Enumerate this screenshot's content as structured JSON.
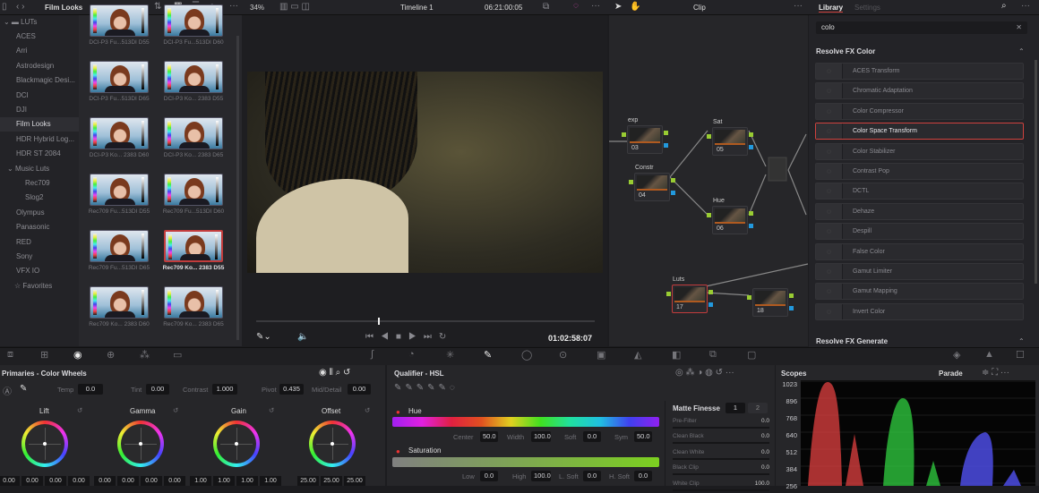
{
  "topbar": {
    "bin_title": "Film Looks",
    "zoom": "34%",
    "timeline": "Timeline 1",
    "timecode": "06:21:00:05",
    "node_mode": "Clip"
  },
  "sidebar": {
    "root": "LUTs",
    "items": [
      {
        "label": "ACES"
      },
      {
        "label": "Arri"
      },
      {
        "label": "Astrodesign"
      },
      {
        "label": "Blackmagic Desi..."
      },
      {
        "label": "DCI"
      },
      {
        "label": "DJI"
      },
      {
        "label": "Film Looks",
        "selected": true
      },
      {
        "label": "HDR Hybrid Log..."
      },
      {
        "label": "HDR ST 2084"
      },
      {
        "label": "Music Luts"
      },
      {
        "label": "Rec709"
      },
      {
        "label": "Slog2"
      },
      {
        "label": "Olympus"
      },
      {
        "label": "Panasonic"
      },
      {
        "label": "RED"
      },
      {
        "label": "Sony"
      },
      {
        "label": "VFX IO"
      },
      {
        "label": "Favorites"
      }
    ]
  },
  "luts": [
    "DCI-P3 Fu...513DI D55",
    "DCI-P3 Fu...513DI D60",
    "DCI-P3 Fu...513DI D65",
    "DCI-P3 Ko... 2383 D55",
    "DCI-P3 Ko... 2383 D60",
    "DCI-P3 Ko... 2383 D65",
    "Rec709 Fu...513DI D55",
    "Rec709 Fu...513DI D60",
    "Rec709 Fu...513DI D65",
    "Rec709 Ko... 2383 D55",
    "Rec709 Ko... 2383 D60",
    "Rec709 Ko... 2383 D65"
  ],
  "viewer": {
    "timecode": "01:02:58:07",
    "playhead_fraction": 0.36
  },
  "nodes": [
    {
      "label": "exp",
      "num": "03"
    },
    {
      "label": "Constr",
      "num": "04"
    },
    {
      "label": "Sat",
      "num": "05"
    },
    {
      "label": "Hue",
      "num": "06"
    },
    {
      "label": "Luts",
      "num": "17"
    },
    {
      "label": "",
      "num": "18"
    }
  ],
  "library": {
    "tabs": [
      "Library",
      "Settings"
    ],
    "search": "colo",
    "section1": "Resolve FX Color",
    "section2": "Resolve FX Generate",
    "items": [
      "ACES Transform",
      "Chromatic Adaptation",
      "Color Compressor",
      "Color Space Transform",
      "Color Stabilizer",
      "Contrast Pop",
      "DCTL",
      "Dehaze",
      "Despill",
      "False Color",
      "Gamut Limiter",
      "Gamut Mapping",
      "Invert Color"
    ],
    "selected": "Color Space Transform"
  },
  "primaries": {
    "title": "Primaries - Color Wheels",
    "temp_label": "Temp",
    "temp": "0.0",
    "tint_label": "Tint",
    "tint": "0.00",
    "contrast_label": "Contrast",
    "contrast": "1.000",
    "pivot_label": "Pivot",
    "pivot": "0.435",
    "md_label": "Mid/Detail",
    "md": "0.00",
    "wheels": [
      {
        "name": "Lift",
        "values": [
          "0.00",
          "0.00",
          "0.00",
          "0.00"
        ]
      },
      {
        "name": "Gamma",
        "values": [
          "0.00",
          "0.00",
          "0.00",
          "0.00"
        ]
      },
      {
        "name": "Gain",
        "values": [
          "1.00",
          "1.00",
          "1.00",
          "1.00"
        ]
      },
      {
        "name": "Offset",
        "values": [
          "25.00",
          "25.00",
          "25.00"
        ]
      }
    ]
  },
  "qualifier": {
    "title": "Qualifier - HSL",
    "hue": "Hue",
    "saturation": "Saturation",
    "center_label": "Center",
    "center": "50.0",
    "width_label": "Width",
    "width": "100.0",
    "soft_label": "Soft",
    "soft": "0.0",
    "sym_label": "Sym",
    "sym": "50.0",
    "low_label": "Low",
    "low": "0.0",
    "high_label": "High",
    "high": "100.0",
    "lsoft_label": "L. Soft",
    "lsoft": "0.0",
    "hsoft_label": "H. Soft",
    "hsoft": "0.0"
  },
  "matte": {
    "title": "Matte Finesse",
    "tab1": "1",
    "tab2": "2",
    "rows": [
      {
        "label": "Pre-Filter",
        "value": "0.0"
      },
      {
        "label": "Clean Black",
        "value": "0.0"
      },
      {
        "label": "Clean White",
        "value": "0.0"
      },
      {
        "label": "Black Clip",
        "value": "0.0"
      },
      {
        "label": "White Clip",
        "value": "100.0"
      }
    ]
  },
  "scopes": {
    "title": "Scopes",
    "mode": "Parade",
    "ticks": [
      "1023",
      "896",
      "768",
      "640",
      "512",
      "384",
      "256"
    ]
  },
  "colors": {
    "accent_red": "#d0423e",
    "selected_border": "#c23c3c"
  }
}
